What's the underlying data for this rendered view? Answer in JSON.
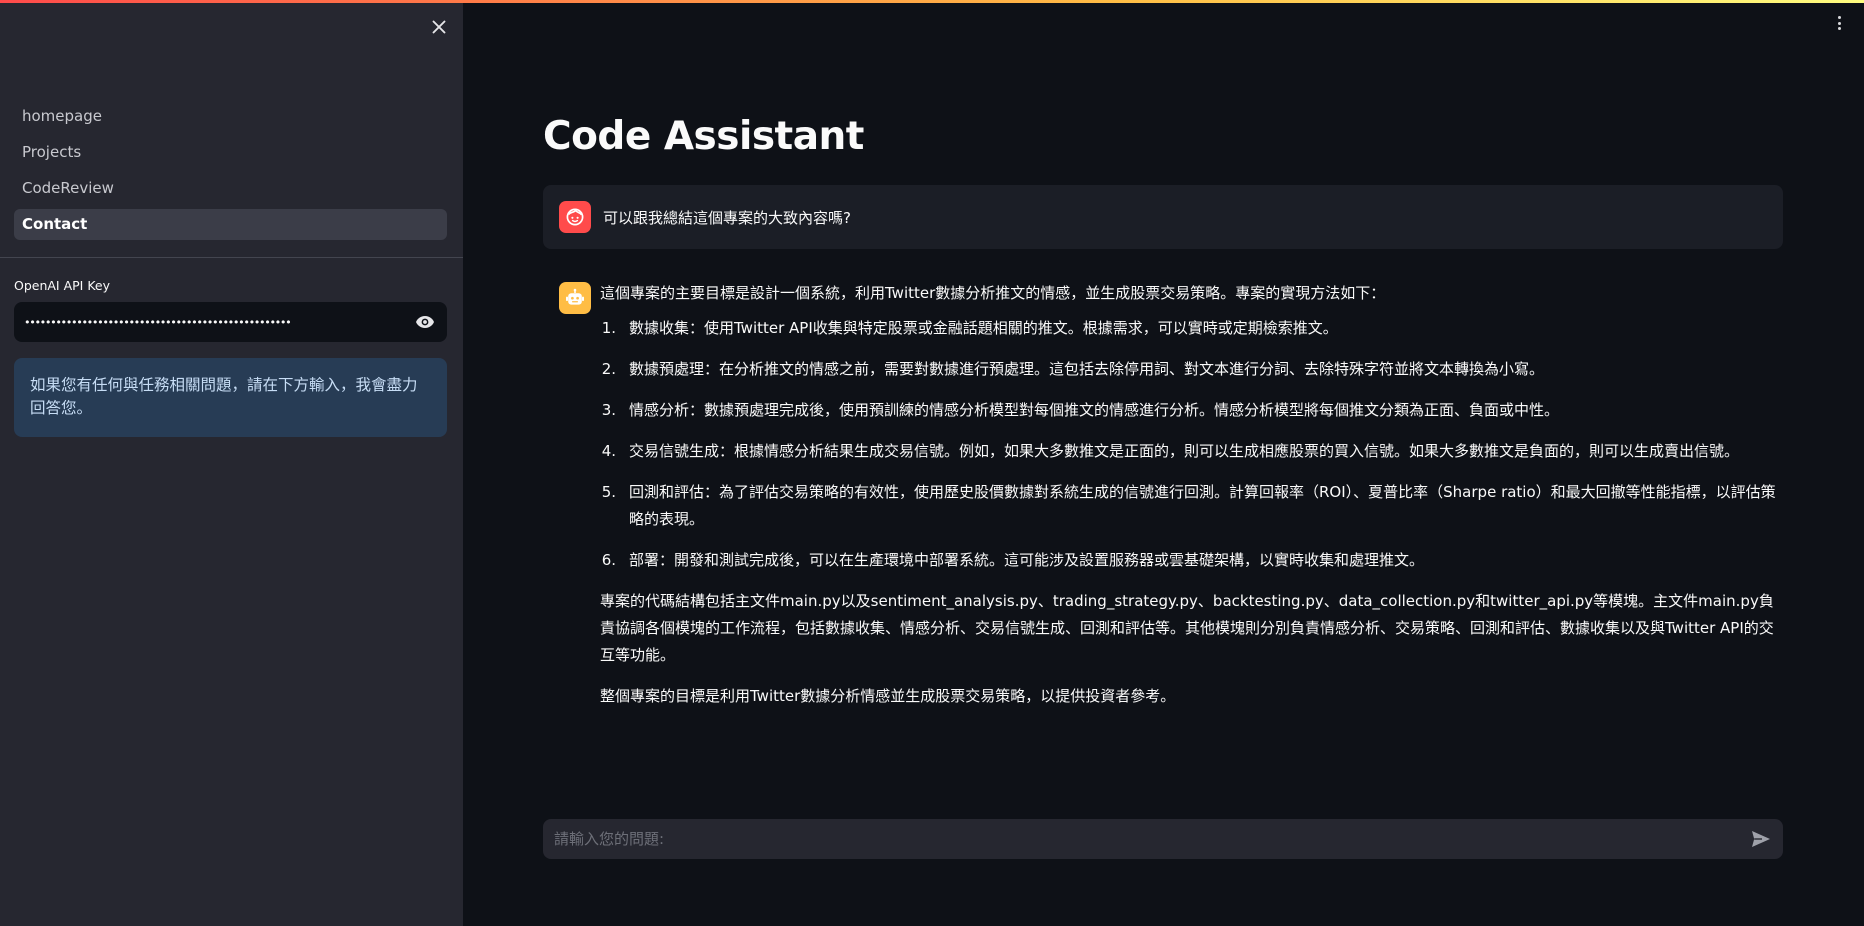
{
  "sidebar": {
    "close_icon": "close-icon",
    "nav_items": [
      {
        "label": "homepage",
        "active": false
      },
      {
        "label": "Projects",
        "active": false
      },
      {
        "label": "CodeReview",
        "active": false
      },
      {
        "label": "Contact",
        "active": true
      }
    ],
    "api_key": {
      "label": "OpenAI API Key",
      "value": "•••••••••••••••••••••••••••••••••••••••••••••••••••",
      "toggle_icon": "eye-icon"
    },
    "info_message": "如果您有任何與任務相關問題，請在下方輸入，我會盡力回答您。"
  },
  "header": {
    "menu_icon": "more-vertical-icon"
  },
  "main": {
    "title": "Code Assistant",
    "messages": {
      "user": {
        "avatar_icon": "user-face-icon",
        "text": "可以跟我總結這個專案的大致內容嗎?"
      },
      "assistant": {
        "avatar_icon": "robot-icon",
        "intro": "這個專案的主要目標是設計一個系統，利用Twitter數據分析推文的情感，並生成股票交易策略。專案的實現方法如下：",
        "steps": [
          {
            "num": "1.",
            "text": "數據收集：使用Twitter API收集與特定股票或金融話題相關的推文。根據需求，可以實時或定期檢索推文。"
          },
          {
            "num": "2.",
            "text": "數據預處理：在分析推文的情感之前，需要對數據進行預處理。這包括去除停用詞、對文本進行分詞、去除特殊字符並將文本轉換為小寫。"
          },
          {
            "num": "3.",
            "text": "情感分析：數據預處理完成後，使用預訓練的情感分析模型對每個推文的情感進行分析。情感分析模型將每個推文分類為正面、負面或中性。"
          },
          {
            "num": "4.",
            "text": "交易信號生成：根據情感分析結果生成交易信號。例如，如果大多數推文是正面的，則可以生成相應股票的買入信號。如果大多數推文是負面的，則可以生成賣出信號。"
          },
          {
            "num": "5.",
            "text": "回測和評估：為了評估交易策略的有效性，使用歷史股價數據對系統生成的信號進行回測。計算回報率（ROI）、夏普比率（Sharpe ratio）和最大回撤等性能指標，以評估策略的表現。"
          },
          {
            "num": "6.",
            "text": "部署：開發和測試完成後，可以在生產環境中部署系統。這可能涉及設置服務器或雲基礎架構，以實時收集和處理推文。"
          }
        ],
        "summary": "專案的代碼結構包括主文件main.py以及sentiment_analysis.py、trading_strategy.py、backtesting.py、data_collection.py和twitter_api.py等模塊。主文件main.py負責協調各個模塊的工作流程，包括數據收集、情感分析、交易信號生成、回測和評估等。其他模塊則分別負責情感分析、交易策略、回測和評估、數據收集以及與Twitter API的交互等功能。",
        "conclusion": "整個專案的目標是利用Twitter數據分析情感並生成股票交易策略，以提供投資者參考。"
      }
    }
  },
  "chat_input": {
    "placeholder": "請輸入您的問題:",
    "send_icon": "send-icon"
  },
  "colors": {
    "background": "#0e1117",
    "sidebar": "#262730",
    "accent_red": "#ff4b4b",
    "accent_yellow": "#ffbd45",
    "info_bg": "#273c55"
  }
}
